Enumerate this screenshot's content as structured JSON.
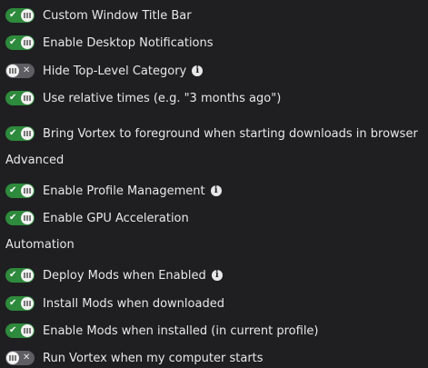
{
  "settings": [
    {
      "label": "Custom Window Title Bar",
      "on": true
    },
    {
      "label": "Enable Desktop Notifications",
      "on": true
    },
    {
      "label": "Hide Top-Level Category",
      "on": false,
      "info": true
    },
    {
      "label": "Use relative times (e.g. \"3 months ago\")",
      "on": true
    },
    {
      "label": "Bring Vortex to foreground when starting downloads in browser",
      "on": true
    }
  ],
  "advanced": {
    "title": "Advanced",
    "items": [
      {
        "label": "Enable Profile Management",
        "on": true,
        "info": true
      },
      {
        "label": "Enable GPU Acceleration",
        "on": true
      }
    ]
  },
  "automation": {
    "title": "Automation",
    "items": [
      {
        "label": "Deploy Mods when Enabled",
        "on": true,
        "info": true
      },
      {
        "label": "Install Mods when downloaded",
        "on": true
      },
      {
        "label": "Enable Mods when installed (in current profile)",
        "on": true
      },
      {
        "label": "Run Vortex when my computer starts",
        "on": false
      }
    ]
  },
  "icons": {
    "on_mark": "check-icon",
    "off_mark": "x-icon",
    "info": "info-icon"
  },
  "colors": {
    "background": "#1f1f22",
    "toggle_on": "#2e8a3c",
    "toggle_off": "#5d5d63",
    "text": "#e8e8e8"
  }
}
